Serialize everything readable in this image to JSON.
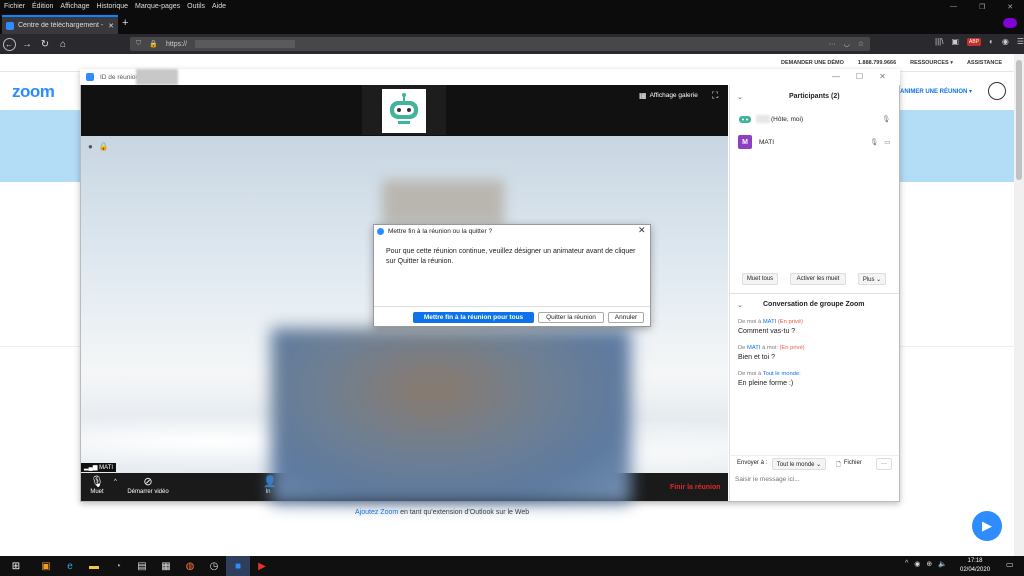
{
  "browser": {
    "menu": [
      "Fichier",
      "Édition",
      "Affichage",
      "Historique",
      "Marque-pages",
      "Outils",
      "Aide"
    ],
    "tab_title": "Centre de téléchargement - Zo",
    "url": "https://"
  },
  "site": {
    "top_links": [
      "DEMANDER UNE DÉMO",
      "1.888.799.9666",
      "RESSOURCES ▾",
      "ASSISTANCE"
    ],
    "logo": "zoom",
    "host_link": "ANIMER UNE RÉUNION ▾",
    "outlook_link": "Ajoutez Zoom",
    "outlook_text": " en tant qu'extension d'Outlook sur le Web"
  },
  "zoom_window": {
    "title": "ID de réunion",
    "gallery_label": "Affichage galerie",
    "participant_label": "MATI",
    "toolbar": {
      "mute": "Muet",
      "video": "Démarrer vidéo",
      "inv": "In",
      "end": "Finir la réunion"
    }
  },
  "dialog": {
    "title": "Mettre fin à la réunion ou la quitter ?",
    "text": "Pour que cette réunion continue, veuillez désigner un animateur avant de cliquer sur Quitter la réunion.",
    "btn_end_all": "Mettre fin à la réunion pour tous",
    "btn_quit": "Quitter la réunion",
    "btn_cancel": "Annuler"
  },
  "participants": {
    "title": "Participants (2)",
    "list": [
      {
        "name": "(Hôte, moi)"
      },
      {
        "initial": "M",
        "name": "MATI"
      }
    ],
    "mute_all": "Muet tous",
    "unmute_all": "Activer les muet",
    "more": "Plus ⌄"
  },
  "chat": {
    "title": "Conversation de groupe Zoom",
    "messages": [
      {
        "from": "De moi à ",
        "to": "MATI",
        "tag": "(En privé)",
        "text": "Comment vas-tu ?"
      },
      {
        "from": "De ",
        "to": "MATI",
        "mid": " à moi: ",
        "tag": "(En privé)",
        "text": "Bien et toi ?"
      },
      {
        "from": "De moi à ",
        "to": "Tout le monde",
        "tag": ":",
        "text": "En pleine forme :)"
      }
    ],
    "send_to_label": "Envoyer à :",
    "send_to_value": "Tout le monde ⌄",
    "file_label": "Fichier",
    "more": "···",
    "placeholder": "Saisir le message ici..."
  },
  "taskbar": {
    "time": "17:18",
    "date": "02/04/2020"
  }
}
